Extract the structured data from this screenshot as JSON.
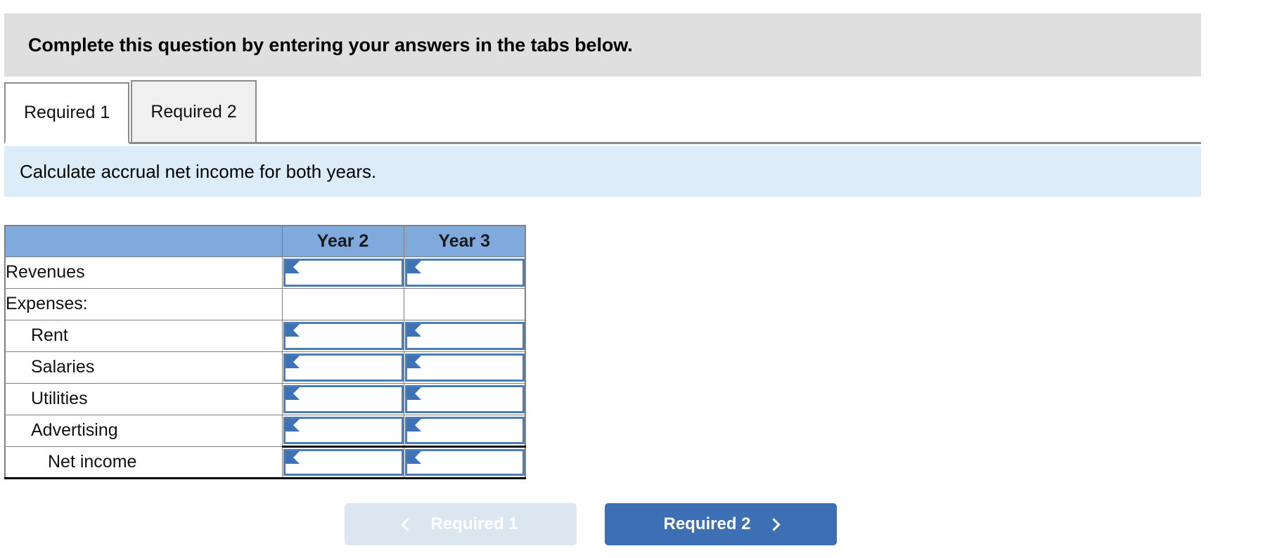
{
  "banner": {
    "text": "Complete this question by entering your answers in the tabs below."
  },
  "tabs": [
    {
      "label": "Required 1",
      "state": "active"
    },
    {
      "label": "Required 2",
      "state": "inactive"
    }
  ],
  "sub_instruction": {
    "text": "Calculate accrual net income for both years."
  },
  "table": {
    "columns": [
      "",
      "Year 2",
      "Year 3"
    ],
    "rows": [
      {
        "label": "Revenues",
        "indent": 0,
        "input": true,
        "total": false,
        "year2": "",
        "year3": ""
      },
      {
        "label": "Expenses:",
        "indent": 0,
        "input": false,
        "total": false,
        "year2": "",
        "year3": ""
      },
      {
        "label": "Rent",
        "indent": 1,
        "input": true,
        "total": false,
        "year2": "",
        "year3": ""
      },
      {
        "label": "Salaries",
        "indent": 1,
        "input": true,
        "total": false,
        "year2": "",
        "year3": ""
      },
      {
        "label": "Utilities",
        "indent": 1,
        "input": true,
        "total": false,
        "year2": "",
        "year3": ""
      },
      {
        "label": "Advertising",
        "indent": 1,
        "input": true,
        "total": false,
        "year2": "",
        "year3": ""
      },
      {
        "label": "Net income",
        "indent": 2,
        "input": true,
        "total": true,
        "year2": "",
        "year3": ""
      }
    ]
  },
  "nav": {
    "prev_label": "Required 1",
    "next_label": "Required 2",
    "prev_icon": "chevron-left-icon",
    "next_icon": "chevron-right-icon"
  },
  "colors": {
    "banner_gray": "#dfdfdf",
    "sub_instruction_blue": "#dcecf9",
    "table_header_blue": "#80aade",
    "input_border_blue": "#4a7ebb",
    "next_button_blue": "#3c6fb4",
    "prev_button_blue": "#dce6f1"
  }
}
